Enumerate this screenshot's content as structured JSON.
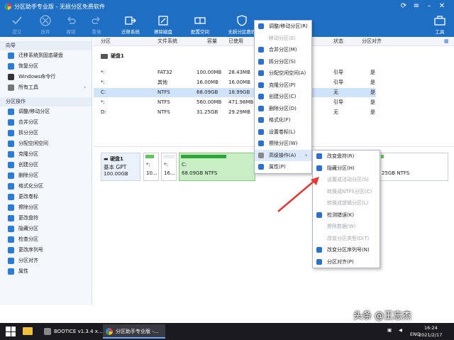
{
  "window": {
    "title": "分区助手专业版 - 无损分区免费软件"
  },
  "toolbar": {
    "buttons": [
      "提交",
      "放弃",
      "撤销",
      "重做",
      "迁移系统",
      "擦除磁盘",
      "配置空间",
      "无损分区教程",
      "工具"
    ]
  },
  "sidebar": {
    "wizard_header": "向导",
    "wizard_items": [
      "迁移系统到固态硬盘",
      "恢复分区",
      "Windows命令行",
      "所有工具"
    ],
    "ops_header": "分区操作",
    "ops_items": [
      "调整/移动分区",
      "合并分区",
      "拆分分区",
      "分配空闲空间",
      "克隆分区",
      "创建分区",
      "删除分区",
      "格式化分区",
      "更改卷标",
      "擦除分区",
      "更改盘符",
      "隐藏分区",
      "检查分区",
      "更改序列号",
      "分区对齐",
      "属性"
    ]
  },
  "table": {
    "columns": [
      "分区",
      "文件系统",
      "容量",
      "已使用",
      "状态",
      "分区对齐"
    ],
    "disk_label": "硬盘1",
    "rows": [
      {
        "name": "*:",
        "fs": "FAT32",
        "cap": "100.00MB",
        "used": "28.43MB",
        "status": "引导",
        "align": "是",
        "fill": 0.28
      },
      {
        "name": "*:",
        "fs": "其他",
        "cap": "16.00MB",
        "used": "16.00MB",
        "status": "引导",
        "align": "是",
        "fill": 1.0
      },
      {
        "name": "C:",
        "fs": "NTFS",
        "cap": "68.09GB",
        "used": "18.99GB",
        "status": "无",
        "align": "是",
        "fill": 0.28
      },
      {
        "name": "*:",
        "fs": "NTFS",
        "cap": "560.00MB",
        "used": "471.98MB",
        "status": "引导",
        "align": "是",
        "fill": 0.84
      },
      {
        "name": "D:",
        "fs": "NTFS",
        "cap": "31.25GB",
        "used": "29.29MB",
        "status": "无",
        "align": "是",
        "fill": 0.02
      }
    ]
  },
  "diskmap": {
    "disk_name": "硬盘1",
    "disk_type": "基本 GPT",
    "disk_size": "100.00GB",
    "parts": [
      {
        "letter": "*:",
        "size": "10...",
        "fill": 0.28
      },
      {
        "letter": "*:",
        "size": "16...",
        "fill": 1.0
      },
      {
        "letter": "C:",
        "size": "68.09GB NTFS",
        "fill": 0.28
      },
      {
        "letter": "",
        "size": "25GB NTFS",
        "fill": 0.02
      }
    ]
  },
  "context_menu": {
    "items": [
      {
        "label": "调整/移动分区",
        "key": "(R)",
        "disabled": false
      },
      {
        "label": "移动分区",
        "key": "(E)",
        "disabled": true
      },
      {
        "label": "合并分区",
        "key": "(M)",
        "disabled": false
      },
      {
        "label": "拆分分区",
        "key": "(S)",
        "disabled": false
      },
      {
        "label": "分配空闲空间",
        "key": "(A)",
        "disabled": false
      },
      {
        "label": "克隆分区",
        "key": "(P)",
        "disabled": false
      },
      {
        "label": "创建分区",
        "key": "(C)",
        "disabled": false
      },
      {
        "label": "删除分区",
        "key": "(D)",
        "disabled": false
      },
      {
        "label": "格式化",
        "key": "(F)",
        "disabled": false
      },
      {
        "label": "设置卷标",
        "key": "(L)",
        "disabled": false
      },
      {
        "label": "擦除分区",
        "key": "(W)",
        "disabled": false
      },
      {
        "label": "高级操作",
        "key": "(A)",
        "disabled": false
      },
      {
        "label": "属性",
        "key": "(P)",
        "disabled": false
      }
    ]
  },
  "submenu": {
    "items": [
      {
        "label": "改变盘符",
        "key": "(R)",
        "disabled": false
      },
      {
        "label": "隐藏分区",
        "key": "(H)",
        "disabled": false
      },
      {
        "label": "设置成活动分区",
        "key": "(S)",
        "disabled": true
      },
      {
        "label": "转换成NTFS分区",
        "key": "(C)",
        "disabled": true
      },
      {
        "label": "转换成逻辑分区",
        "key": "(L)",
        "disabled": true
      },
      {
        "label": "检测错误",
        "key": "(K)",
        "disabled": false
      },
      {
        "label": "擦除数据",
        "key": "(W)",
        "disabled": true
      },
      {
        "label": "改变分区类型ID",
        "key": "(T)",
        "disabled": true
      },
      {
        "label": "改变分区序列号",
        "key": "(N)",
        "disabled": false
      },
      {
        "label": "分区对齐",
        "key": "(P)",
        "disabled": false
      }
    ]
  },
  "taskbar": {
    "tasks": [
      "BOOTICE v1.3.4 x...",
      "分区助手专业版 -..."
    ],
    "lang": "ENG",
    "time": "16:24",
    "date": "2021/2/17"
  },
  "watermark": "头条 @王忘杰",
  "colors": {
    "brand": "#1e6fc3",
    "selection": "#cfe3fb",
    "partition_green": "#5cc85a",
    "arrow": "#e53935"
  }
}
